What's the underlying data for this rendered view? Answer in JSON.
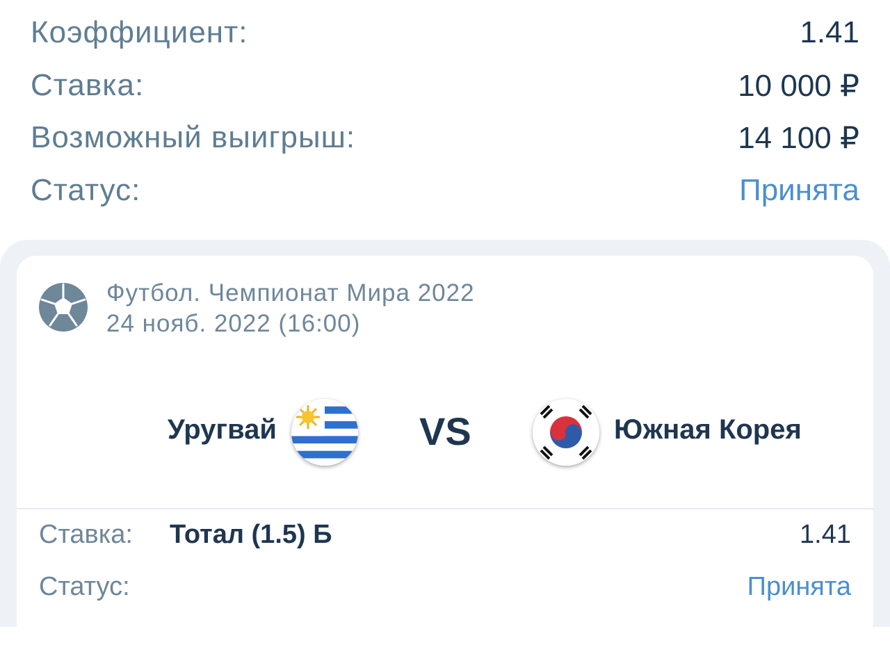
{
  "summary": {
    "rows": [
      {
        "label": "Коэффициент:",
        "value": "1.41"
      },
      {
        "label": "Ставка:",
        "value": "10 000 ₽"
      },
      {
        "label": "Возможный выигрыш:",
        "value": "14 100 ₽"
      },
      {
        "label": "Статус:",
        "value": "Принята"
      }
    ]
  },
  "event": {
    "sport_icon": "soccer-ball-icon",
    "league": "Футбол. Чемпионат Мира 2022",
    "date": "24 нояб. 2022 (16:00)",
    "team_home": "Уругвай",
    "team_home_flag": "uruguay-flag-icon",
    "vs": "VS",
    "team_away": "Южная Корея",
    "team_away_flag": "south-korea-flag-icon"
  },
  "bet": {
    "stake_label": "Ставка:",
    "selection": "Тотал (1.5) Б",
    "odds": "1.41",
    "status_label": "Статус:",
    "status": "Принята"
  },
  "colors": {
    "label": "#5f7d92",
    "value": "#1d3650",
    "accepted": "#4b8fcf",
    "card_bg": "#eef2f6"
  }
}
